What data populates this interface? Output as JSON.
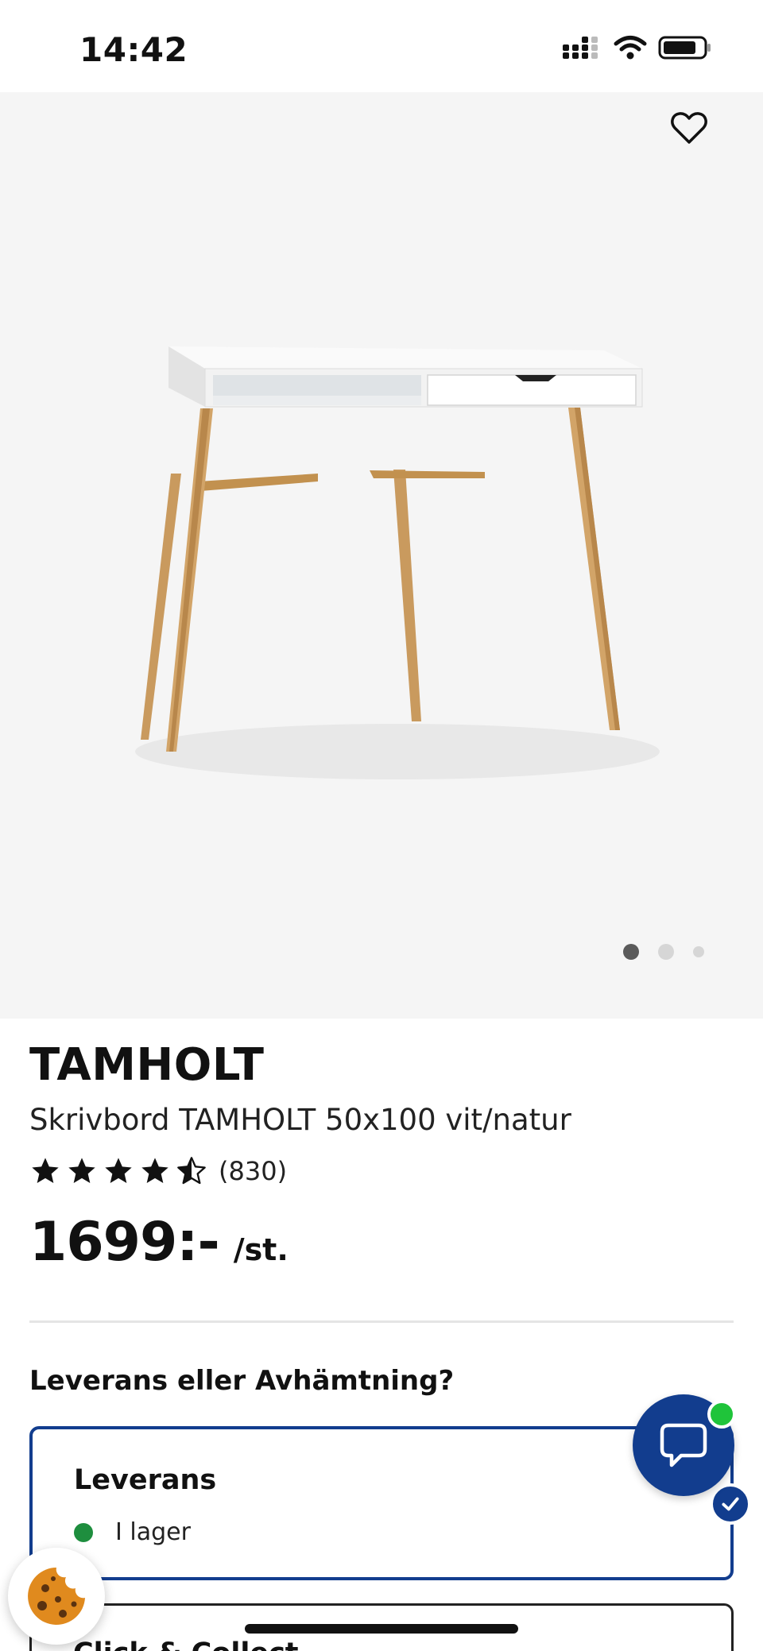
{
  "status_bar": {
    "time": "14:42"
  },
  "gallery": {
    "page_count": 3,
    "active_index": 0
  },
  "product": {
    "name": "TAMHOLT",
    "description": "Skrivbord TAMHOLT 50x100 vit/natur",
    "rating": 4.5,
    "rating_count": "(830)",
    "price": "1699:-",
    "price_unit": "/st."
  },
  "delivery": {
    "title": "Leverans eller Avhämtning?",
    "options": [
      {
        "title": "Leverans",
        "stock_text": "I lager",
        "selected": true
      },
      {
        "title": "Click & Collect",
        "selected": false
      }
    ]
  },
  "colors": {
    "brand_blue": "#123d8e",
    "in_stock_green": "#1e8e3e",
    "online_green": "#1fc43a",
    "gallery_bg": "#f5f5f5"
  },
  "icons": [
    "signal-icon",
    "wifi-icon",
    "battery-icon",
    "heart-icon",
    "star-icon",
    "check-icon",
    "chat-icon",
    "cookie-icon"
  ]
}
